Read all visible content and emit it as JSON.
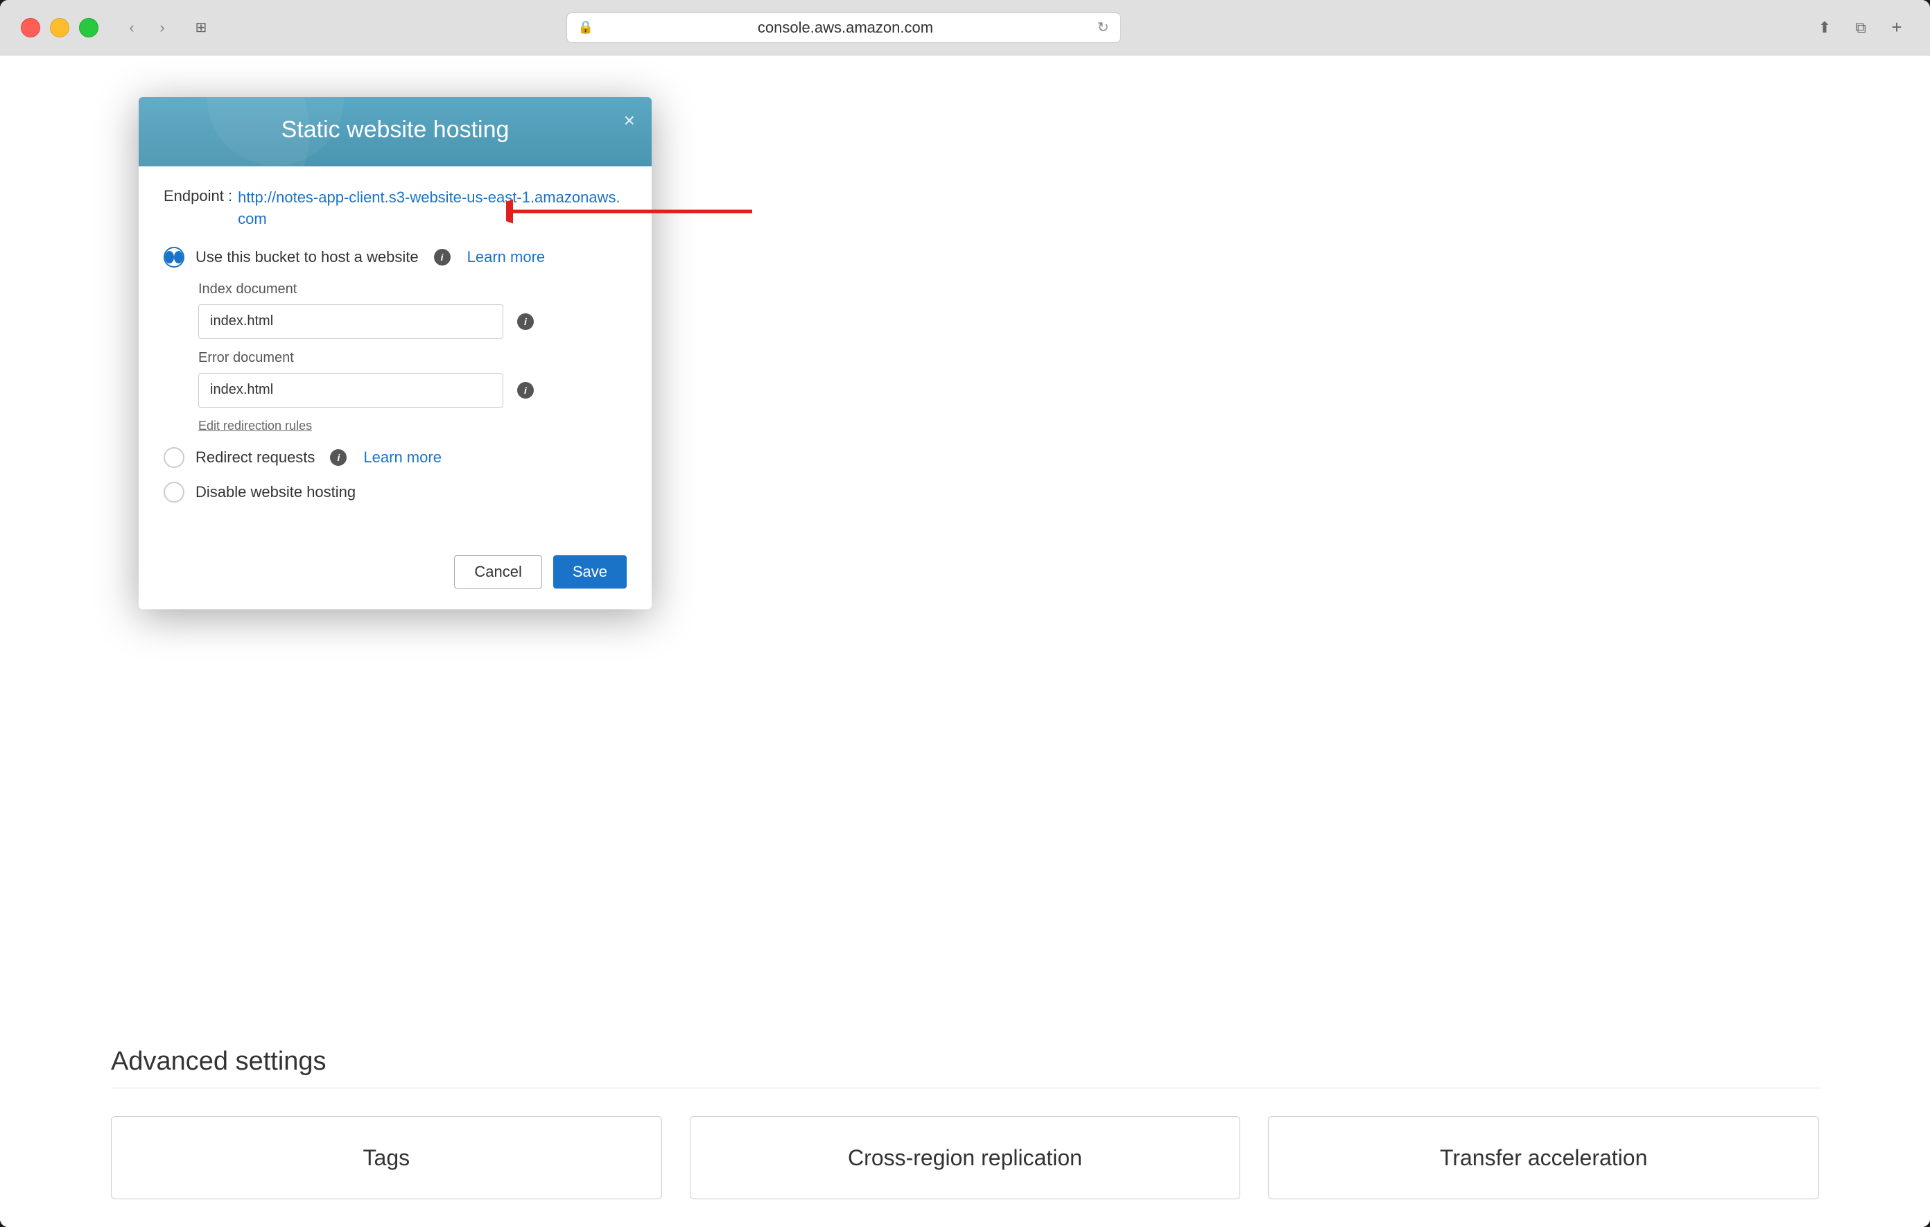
{
  "browser": {
    "url": "console.aws.amazon.com"
  },
  "modal": {
    "title": "Static website hosting",
    "close_label": "×",
    "endpoint_label": "Endpoint :",
    "endpoint_url": "http://notes-app-client.s3-website-us-east-1.amazonaws.com",
    "options": [
      {
        "id": "host",
        "label": "Use this bucket to host a website",
        "selected": true,
        "has_info": true,
        "learn_more": "Learn more"
      },
      {
        "id": "redirect",
        "label": "Redirect requests",
        "selected": false,
        "has_info": true,
        "learn_more": "Learn more"
      },
      {
        "id": "disable",
        "label": "Disable website hosting",
        "selected": false,
        "has_info": false,
        "learn_more": ""
      }
    ],
    "index_document_label": "Index document",
    "index_document_value": "index.html",
    "error_document_label": "Error document",
    "error_document_value": "index.html",
    "edit_rules_label": "Edit redirection rules",
    "cancel_label": "Cancel",
    "save_label": "Save"
  },
  "advanced": {
    "title": "Advanced settings",
    "cards": [
      {
        "label": "Tags"
      },
      {
        "label": "Cross-region replication"
      },
      {
        "label": "Transfer acceleration"
      }
    ]
  }
}
